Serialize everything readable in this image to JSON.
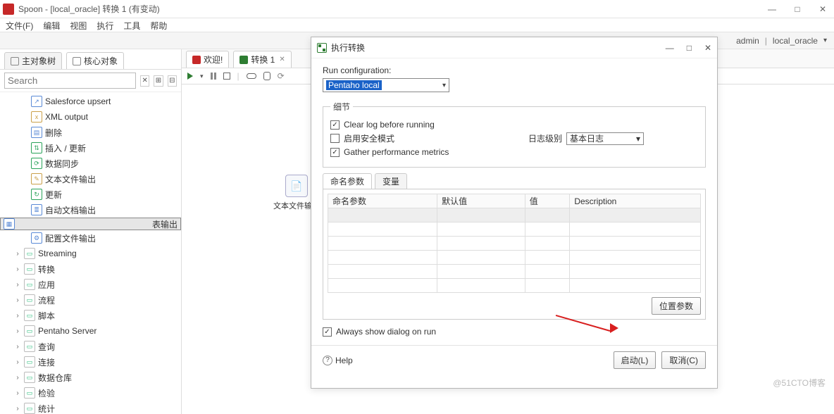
{
  "window": {
    "title": "Spoon - [local_oracle] 转换 1 (有变动)"
  },
  "win_btns": {
    "min": "—",
    "max": "□",
    "close": "✕"
  },
  "menubar": [
    "文件(F)",
    "编辑",
    "视图",
    "执行",
    "工具",
    "帮助"
  ],
  "identity": {
    "user": "admin",
    "repo": "local_oracle"
  },
  "left_tabs": {
    "tree": "主对象树",
    "core": "核心对象"
  },
  "search": {
    "placeholder": "Search"
  },
  "tree": {
    "items": [
      {
        "label": "Salesforce upsert",
        "iconCls": "bl",
        "indent": 2
      },
      {
        "label": "XML output",
        "iconCls": "or",
        "indent": 2
      },
      {
        "label": "删除",
        "iconCls": "bl",
        "indent": 2
      },
      {
        "label": "插入 / 更新",
        "iconCls": "green",
        "indent": 2
      },
      {
        "label": "数据同步",
        "iconCls": "green",
        "indent": 2
      },
      {
        "label": "文本文件输出",
        "iconCls": "or",
        "indent": 2
      },
      {
        "label": "更新",
        "iconCls": "green",
        "indent": 2
      },
      {
        "label": "自动文档输出",
        "iconCls": "bl",
        "indent": 2
      },
      {
        "label": "表输出",
        "iconCls": "bl",
        "indent": 2,
        "selected": true
      },
      {
        "label": "配置文件输出",
        "iconCls": "bl",
        "indent": 2
      }
    ],
    "folders": [
      {
        "label": "Streaming"
      },
      {
        "label": "转换"
      },
      {
        "label": "应用"
      },
      {
        "label": "流程"
      },
      {
        "label": "脚本"
      },
      {
        "label": "Pentaho Server"
      },
      {
        "label": "查询"
      },
      {
        "label": "连接"
      },
      {
        "label": "数据仓库"
      },
      {
        "label": "检验"
      },
      {
        "label": "统计"
      }
    ]
  },
  "right_tabs": {
    "welcome": "欢迎!",
    "trans": "转换 1",
    "close": "✕"
  },
  "canvas": {
    "step1": "文本文件输入"
  },
  "dialog": {
    "title": "执行转换",
    "run_conf_label": "Run configuration:",
    "run_conf_value": "Pentaho local",
    "details_legend": "细节",
    "chk_clear": "Clear log before running",
    "chk_safe": "启用安全模式",
    "chk_perf": "Gather performance metrics",
    "log_level_label": "日志级别",
    "log_level_value": "基本日志",
    "tab_params": "命名参数",
    "tab_vars": "变量",
    "th": {
      "name": "命名参数",
      "def": "默认值",
      "val": "值",
      "desc": "Description"
    },
    "btn_pos": "位置参数",
    "always_show": "Always show dialog on run",
    "help": "Help",
    "launch": "启动(L)",
    "cancel": "取消(C)"
  },
  "watermark": "@51CTO博客"
}
